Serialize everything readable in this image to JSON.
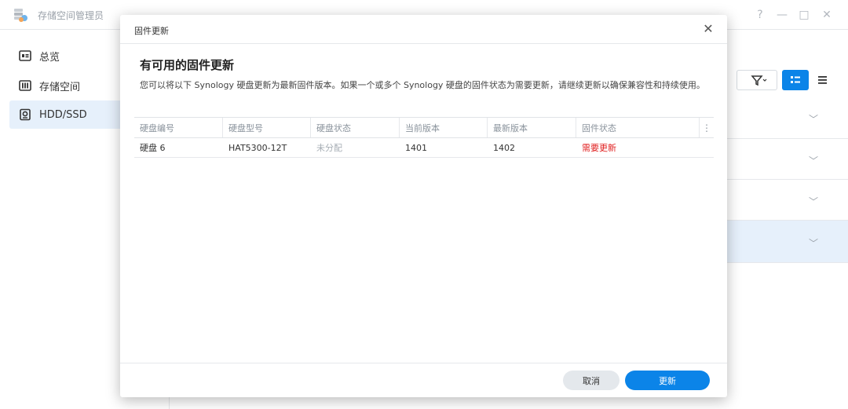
{
  "app": {
    "title": "存储空间管理员",
    "window_controls": {
      "help": "?",
      "minimize": "—",
      "maximize": "□",
      "close": "✕"
    }
  },
  "sidebar": {
    "items": [
      {
        "label": "总览",
        "icon": "overview-icon",
        "active": false
      },
      {
        "label": "存储空间",
        "icon": "storage-icon",
        "active": false
      },
      {
        "label": "HDD/SSD",
        "icon": "disk-icon",
        "active": true
      }
    ]
  },
  "toolbar": {
    "filter_icon": "filter-icon",
    "list_view_icon": "detail-list-icon",
    "menu_icon": "menu-icon"
  },
  "dialog": {
    "title": "固件更新",
    "heading": "有可用的固件更新",
    "description": "您可以将以下 Synology 硬盘更新为最新固件版本。如果一个或多个 Synology 硬盘的固件状态为需要更新，请继续更新以确保兼容性和持续使用。",
    "table": {
      "columns": [
        "硬盘编号",
        "硬盘型号",
        "硬盘状态",
        "当前版本",
        "最新版本",
        "固件状态"
      ],
      "rows": [
        {
          "drive": "硬盘 6",
          "model": "HAT5300-12T",
          "status": "未分配",
          "current": "1401",
          "latest": "1402",
          "firmware": "需要更新"
        }
      ]
    },
    "buttons": {
      "cancel": "取消",
      "update": "更新"
    }
  },
  "colors": {
    "accent": "#0b84e8",
    "warning": "#e02020",
    "active_bg": "#e6f0fb"
  }
}
